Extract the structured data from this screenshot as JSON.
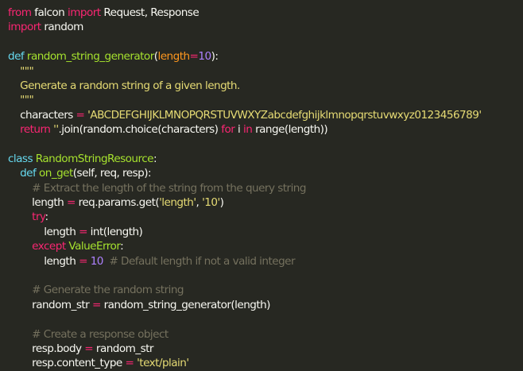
{
  "code_lines": [
    [
      [
        "kw",
        "from"
      ],
      [
        "plain",
        " falcon "
      ],
      [
        "kw",
        "import"
      ],
      [
        "plain",
        " Request, Response"
      ]
    ],
    [
      [
        "kw",
        "import"
      ],
      [
        "plain",
        " random"
      ]
    ],
    [],
    [
      [
        "def",
        "def"
      ],
      [
        "plain",
        " "
      ],
      [
        "fn",
        "random_string_generator"
      ],
      [
        "plain",
        "("
      ],
      [
        "param",
        "length"
      ],
      [
        "kw",
        "="
      ],
      [
        "num",
        "10"
      ],
      [
        "plain",
        "):"
      ]
    ],
    [
      [
        "plain",
        "    "
      ],
      [
        "str",
        "\"\"\""
      ]
    ],
    [
      [
        "plain",
        "    "
      ],
      [
        "str",
        "Generate a random string of a given length."
      ]
    ],
    [
      [
        "plain",
        "    "
      ],
      [
        "str",
        "\"\"\""
      ]
    ],
    [
      [
        "plain",
        "    characters "
      ],
      [
        "kw",
        "="
      ],
      [
        "plain",
        " "
      ],
      [
        "str",
        "'ABCDEFGHIJKLMNOPQRSTUVWXYZabcdefghijklmnopqrstuvwxyz0123456789'"
      ]
    ],
    [
      [
        "plain",
        "    "
      ],
      [
        "kw",
        "return"
      ],
      [
        "plain",
        " "
      ],
      [
        "str",
        "''"
      ],
      [
        "plain",
        ".join(random.choice(characters) "
      ],
      [
        "kw",
        "for"
      ],
      [
        "plain",
        " i "
      ],
      [
        "kw",
        "in"
      ],
      [
        "plain",
        " range(length))"
      ]
    ],
    [],
    [
      [
        "def",
        "class"
      ],
      [
        "plain",
        " "
      ],
      [
        "cls",
        "RandomStringResource"
      ],
      [
        "plain",
        ":"
      ]
    ],
    [
      [
        "plain",
        "    "
      ],
      [
        "def",
        "def"
      ],
      [
        "plain",
        " "
      ],
      [
        "fn",
        "on_get"
      ],
      [
        "plain",
        "(self, req, resp):"
      ]
    ],
    [
      [
        "plain",
        "        "
      ],
      [
        "com",
        "# Extract the length of the string from the query string"
      ]
    ],
    [
      [
        "plain",
        "        length "
      ],
      [
        "kw",
        "="
      ],
      [
        "plain",
        " req.params.get("
      ],
      [
        "str",
        "'length'"
      ],
      [
        "plain",
        ", "
      ],
      [
        "str",
        "'10'"
      ],
      [
        "plain",
        ")"
      ]
    ],
    [
      [
        "plain",
        "        "
      ],
      [
        "kw",
        "try"
      ],
      [
        "plain",
        ":"
      ]
    ],
    [
      [
        "plain",
        "            length "
      ],
      [
        "kw",
        "="
      ],
      [
        "plain",
        " int(length)"
      ]
    ],
    [
      [
        "plain",
        "        "
      ],
      [
        "kw",
        "except"
      ],
      [
        "plain",
        " "
      ],
      [
        "cls",
        "ValueError"
      ],
      [
        "plain",
        ":"
      ]
    ],
    [
      [
        "plain",
        "            length "
      ],
      [
        "kw",
        "="
      ],
      [
        "plain",
        " "
      ],
      [
        "num",
        "10"
      ],
      [
        "plain",
        "  "
      ],
      [
        "com",
        "# Default length if not a valid integer"
      ]
    ],
    [],
    [
      [
        "plain",
        "        "
      ],
      [
        "com",
        "# Generate the random string"
      ]
    ],
    [
      [
        "plain",
        "        random_str "
      ],
      [
        "kw",
        "="
      ],
      [
        "plain",
        " random_string_generator(length)"
      ]
    ],
    [],
    [
      [
        "plain",
        "        "
      ],
      [
        "com",
        "# Create a response object"
      ]
    ],
    [
      [
        "plain",
        "        resp.body "
      ],
      [
        "kw",
        "="
      ],
      [
        "plain",
        " random_str"
      ]
    ],
    [
      [
        "plain",
        "        resp.content_type "
      ],
      [
        "kw",
        "="
      ],
      [
        "plain",
        " "
      ],
      [
        "str",
        "'text/plain'"
      ]
    ]
  ],
  "colors": {
    "background": "#272822",
    "keyword": "#F92672",
    "definition": "#66D9EF",
    "function_name": "#A6E22E",
    "string": "#E6DB74",
    "number": "#AE81FF",
    "comment": "#75715E",
    "parameter": "#FD971F",
    "text": "#F8F8F2"
  }
}
